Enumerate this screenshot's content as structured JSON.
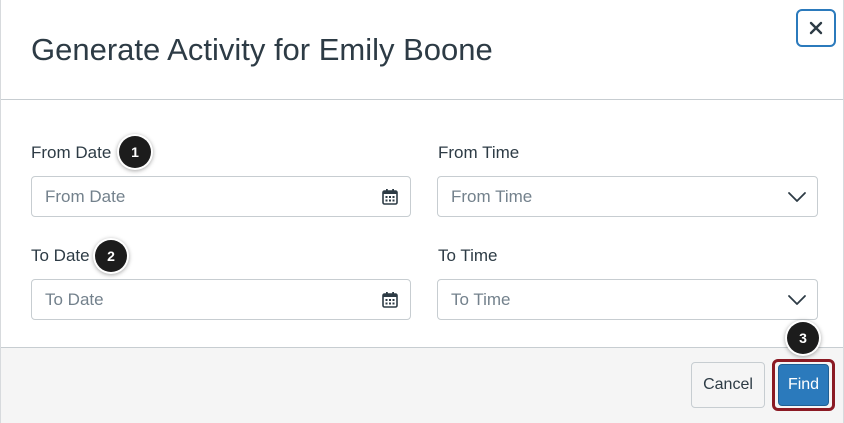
{
  "dialog": {
    "title": "Generate Activity for Emily Boone",
    "close_label": "×"
  },
  "form": {
    "from_date": {
      "label": "From Date",
      "placeholder": "From Date",
      "icon": "calendar-icon"
    },
    "from_time": {
      "label": "From Time",
      "placeholder": "From Time",
      "icon": "chevron-down-icon"
    },
    "to_date": {
      "label": "To Date",
      "placeholder": "To Date",
      "icon": "calendar-icon"
    },
    "to_time": {
      "label": "To Time",
      "placeholder": "To Time",
      "icon": "chevron-down-icon"
    }
  },
  "markers": [
    "1",
    "2",
    "3"
  ],
  "footer": {
    "cancel_label": "Cancel",
    "find_label": "Find"
  },
  "colors": {
    "accent": "#2b7abc",
    "highlight": "#8b1a24",
    "marker": "#1c1c1c",
    "text": "#2d3b45",
    "placeholder": "#73818c"
  }
}
